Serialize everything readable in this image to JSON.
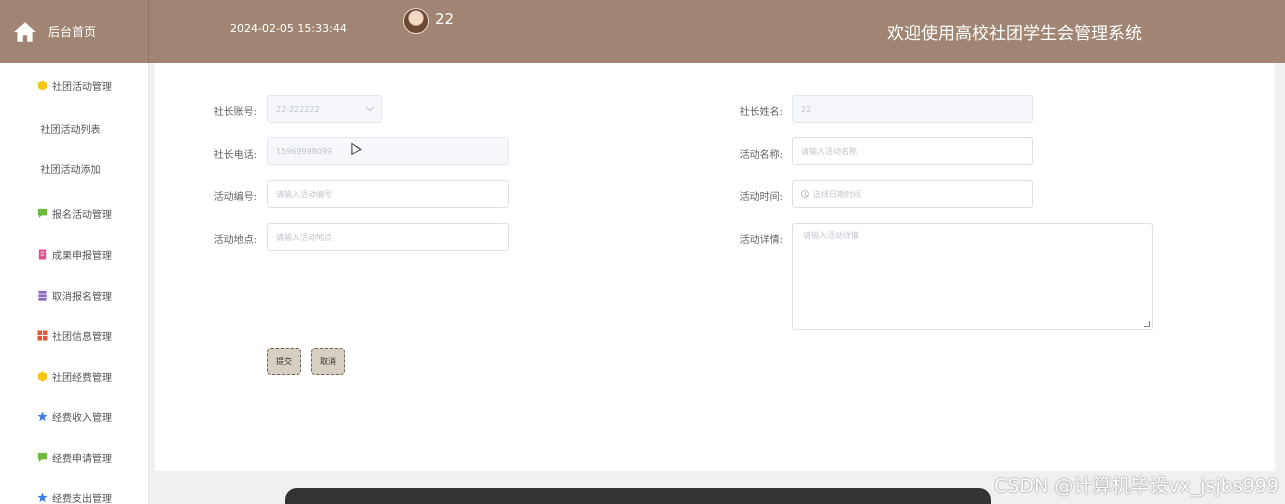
{
  "header": {
    "home_label": "后台首页",
    "datetime": "2024-02-05 15:33:44",
    "username": "22",
    "system_title": "欢迎使用高校社团学生会管理系统"
  },
  "sidebar": {
    "groups": [
      {
        "label": "社团活动管理",
        "icon": "hexagon-icon",
        "color": "#f5c518"
      },
      {
        "label": "报名活动管理",
        "icon": "message-icon",
        "color": "#6dbb3c"
      },
      {
        "label": "成果申报管理",
        "icon": "document-icon",
        "color": "#e24c8b"
      },
      {
        "label": "取消报名管理",
        "icon": "stack-icon",
        "color": "#8a6bb8"
      },
      {
        "label": "社团信息管理",
        "icon": "grid-icon",
        "color": "#e05a3a"
      },
      {
        "label": "社团经费管理",
        "icon": "hexagon-icon",
        "color": "#f5c518"
      },
      {
        "label": "经费收入管理",
        "icon": "star-icon",
        "color": "#3d7de0"
      },
      {
        "label": "经费申请管理",
        "icon": "message-icon",
        "color": "#6dbb3c"
      },
      {
        "label": "经费支出管理",
        "icon": "star-icon",
        "color": "#3d7de0"
      }
    ],
    "subitems": [
      "社团活动列表",
      "社团活动添加"
    ]
  },
  "form": {
    "president_account": {
      "label": "社长账号:",
      "value": "22-222222"
    },
    "president_name": {
      "label": "社长姓名:",
      "value": "22"
    },
    "president_phone": {
      "label": "社长电话:",
      "value": "15969998099"
    },
    "activity_name": {
      "label": "活动名称:",
      "placeholder": "请输入活动名称"
    },
    "activity_code": {
      "label": "活动编号:",
      "placeholder": "请输入活动编号"
    },
    "activity_time": {
      "label": "活动时间:",
      "placeholder": "选择日期时间"
    },
    "activity_location": {
      "label": "活动地点:",
      "placeholder": "请输入活动地点"
    },
    "activity_details": {
      "label": "活动详情:",
      "placeholder": "请输入活动详情"
    },
    "submit_label": "提交",
    "cancel_label": "取消"
  },
  "watermark": "CSDN @计算机毕设vx_jsjbs999",
  "colors": {
    "header_bg": "#a08672",
    "button_bg": "#d5cfc4"
  }
}
